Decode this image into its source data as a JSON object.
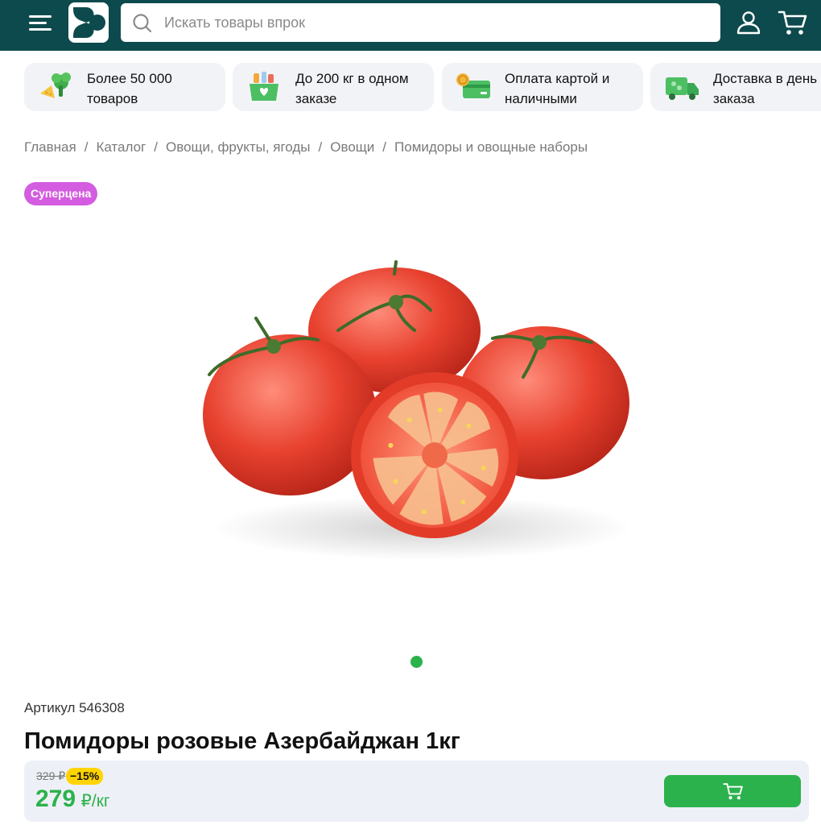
{
  "header": {
    "search_placeholder": "Искать товары впрок",
    "colors": {
      "bar": "#0d4a4d",
      "accent": "#2bb24c"
    },
    "icons": [
      "menu-icon",
      "logo",
      "search-icon",
      "user-icon",
      "cart-icon"
    ]
  },
  "features": [
    {
      "text": "Более 50 000 товаров",
      "icon": "vegetables-icon"
    },
    {
      "text": "До 200 кг в одном заказе",
      "icon": "grocery-box-icon"
    },
    {
      "text": "Оплата картой и наличными",
      "icon": "card-cash-icon"
    },
    {
      "text": "Доставка в день заказа",
      "icon": "delivery-truck-icon"
    }
  ],
  "breadcrumb": [
    "Главная",
    "Каталог",
    "Овощи, фрукты, ягоды",
    "Овощи",
    "Помидоры и овощные наборы"
  ],
  "breadcrumb_separator": "/",
  "badge": "Суперцена",
  "carousel": {
    "total_slides": 1,
    "active_slide": 1
  },
  "product": {
    "article": "Артикул 546308",
    "title": "Помидоры розовые Азербайджан 1кг",
    "old_price": "329 ₽",
    "discount": "−15%",
    "price": "279",
    "unit": "₽/кг",
    "image": "tomatoes-photo"
  }
}
